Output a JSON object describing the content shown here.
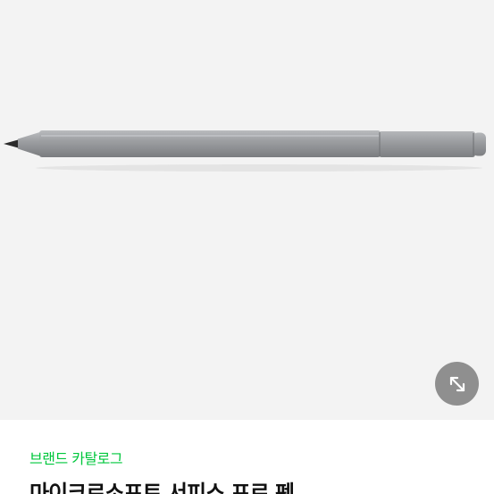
{
  "product": {
    "brand_link_label": "브랜드 카탈로그",
    "title": "마이크로소프트 서피스 프로 펜",
    "image_name": "surface-pen"
  },
  "controls": {
    "expand_icon": "expand-arrows-icon"
  },
  "colors": {
    "hero_background": "#f3f3f3",
    "brand_accent": "#00c73c",
    "title_text": "#111111",
    "expand_button_bg": "#8a8a8a"
  }
}
